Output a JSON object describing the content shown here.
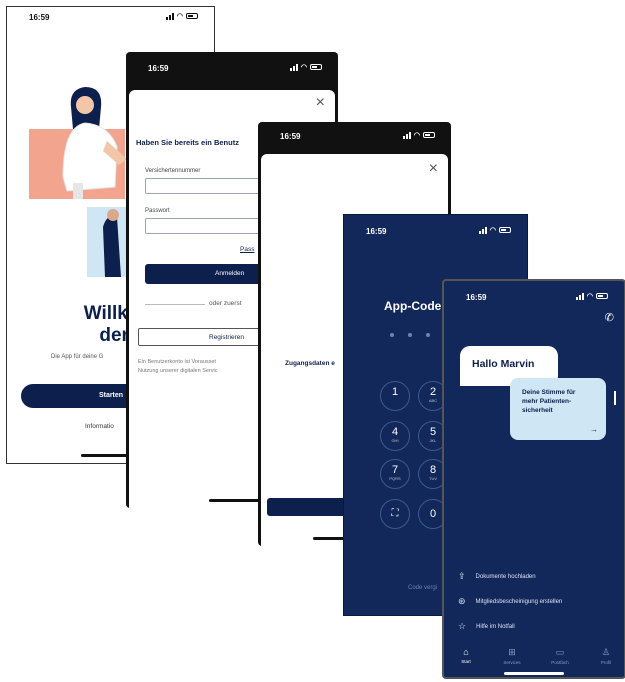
{
  "screen1": {
    "time": "16:59",
    "title_line1": "Willkomm",
    "title_line2": "der KK",
    "subtitle": "Die App für deine G",
    "start_button": "Starten",
    "info_link": "Informatio"
  },
  "screen2": {
    "time": "16:59",
    "heading": "Haben Sie bereits ein Benutz",
    "insurance_label": "Versichertennummer",
    "password_label": "Passwort",
    "forgot_link": "Pass",
    "login_button": "Anmelden",
    "divider_text": "oder zuerst",
    "register_button": "Registrieren",
    "footnote_line1": "Ein Benutzerkonto ist Vorausset",
    "footnote_line2": "Nutzung unserer digitalen Servic"
  },
  "screen3": {
    "time": "16:59",
    "caption": "Zugangsdaten e"
  },
  "screen4": {
    "time": "16:59",
    "title": "App-Code e",
    "keys": [
      {
        "num": "1",
        "letters": ""
      },
      {
        "num": "2",
        "letters": "ABC"
      },
      {
        "num": "4",
        "letters": "GHI"
      },
      {
        "num": "5",
        "letters": "JKL"
      },
      {
        "num": "7",
        "letters": "PQRS"
      },
      {
        "num": "8",
        "letters": "TUV"
      },
      {
        "num": "",
        "letters": ""
      },
      {
        "num": "0",
        "letters": ""
      }
    ],
    "footer_text": "Code vergi"
  },
  "screen5": {
    "time": "16:59",
    "greeting": "Hallo Marvin",
    "card_text_line1": "Deine Stimme für",
    "card_text_line2": "mehr Patienten-",
    "card_text_line3": "sicherheit",
    "card_arrow": "→",
    "menu": [
      {
        "label": "Dokumente hochladen",
        "icon": "upload-icon"
      },
      {
        "label": "Mitgliedsbescheinigung erstellen",
        "icon": "badge-icon"
      },
      {
        "label": "Hilfe im Notfall",
        "icon": "help-icon"
      }
    ],
    "tabs": [
      {
        "label": "Start",
        "icon": "home-icon"
      },
      {
        "label": "Services",
        "icon": "grid-icon"
      },
      {
        "label": "Postfach",
        "icon": "chat-icon"
      },
      {
        "label": "Profil",
        "icon": "profile-icon"
      }
    ]
  },
  "colors": {
    "navy": "#0d1f4c",
    "dark_blue_bg": "#12275a",
    "salmon": "#f2a48f",
    "light_blue": "#cfe6f5",
    "green": "#5fa86a"
  }
}
